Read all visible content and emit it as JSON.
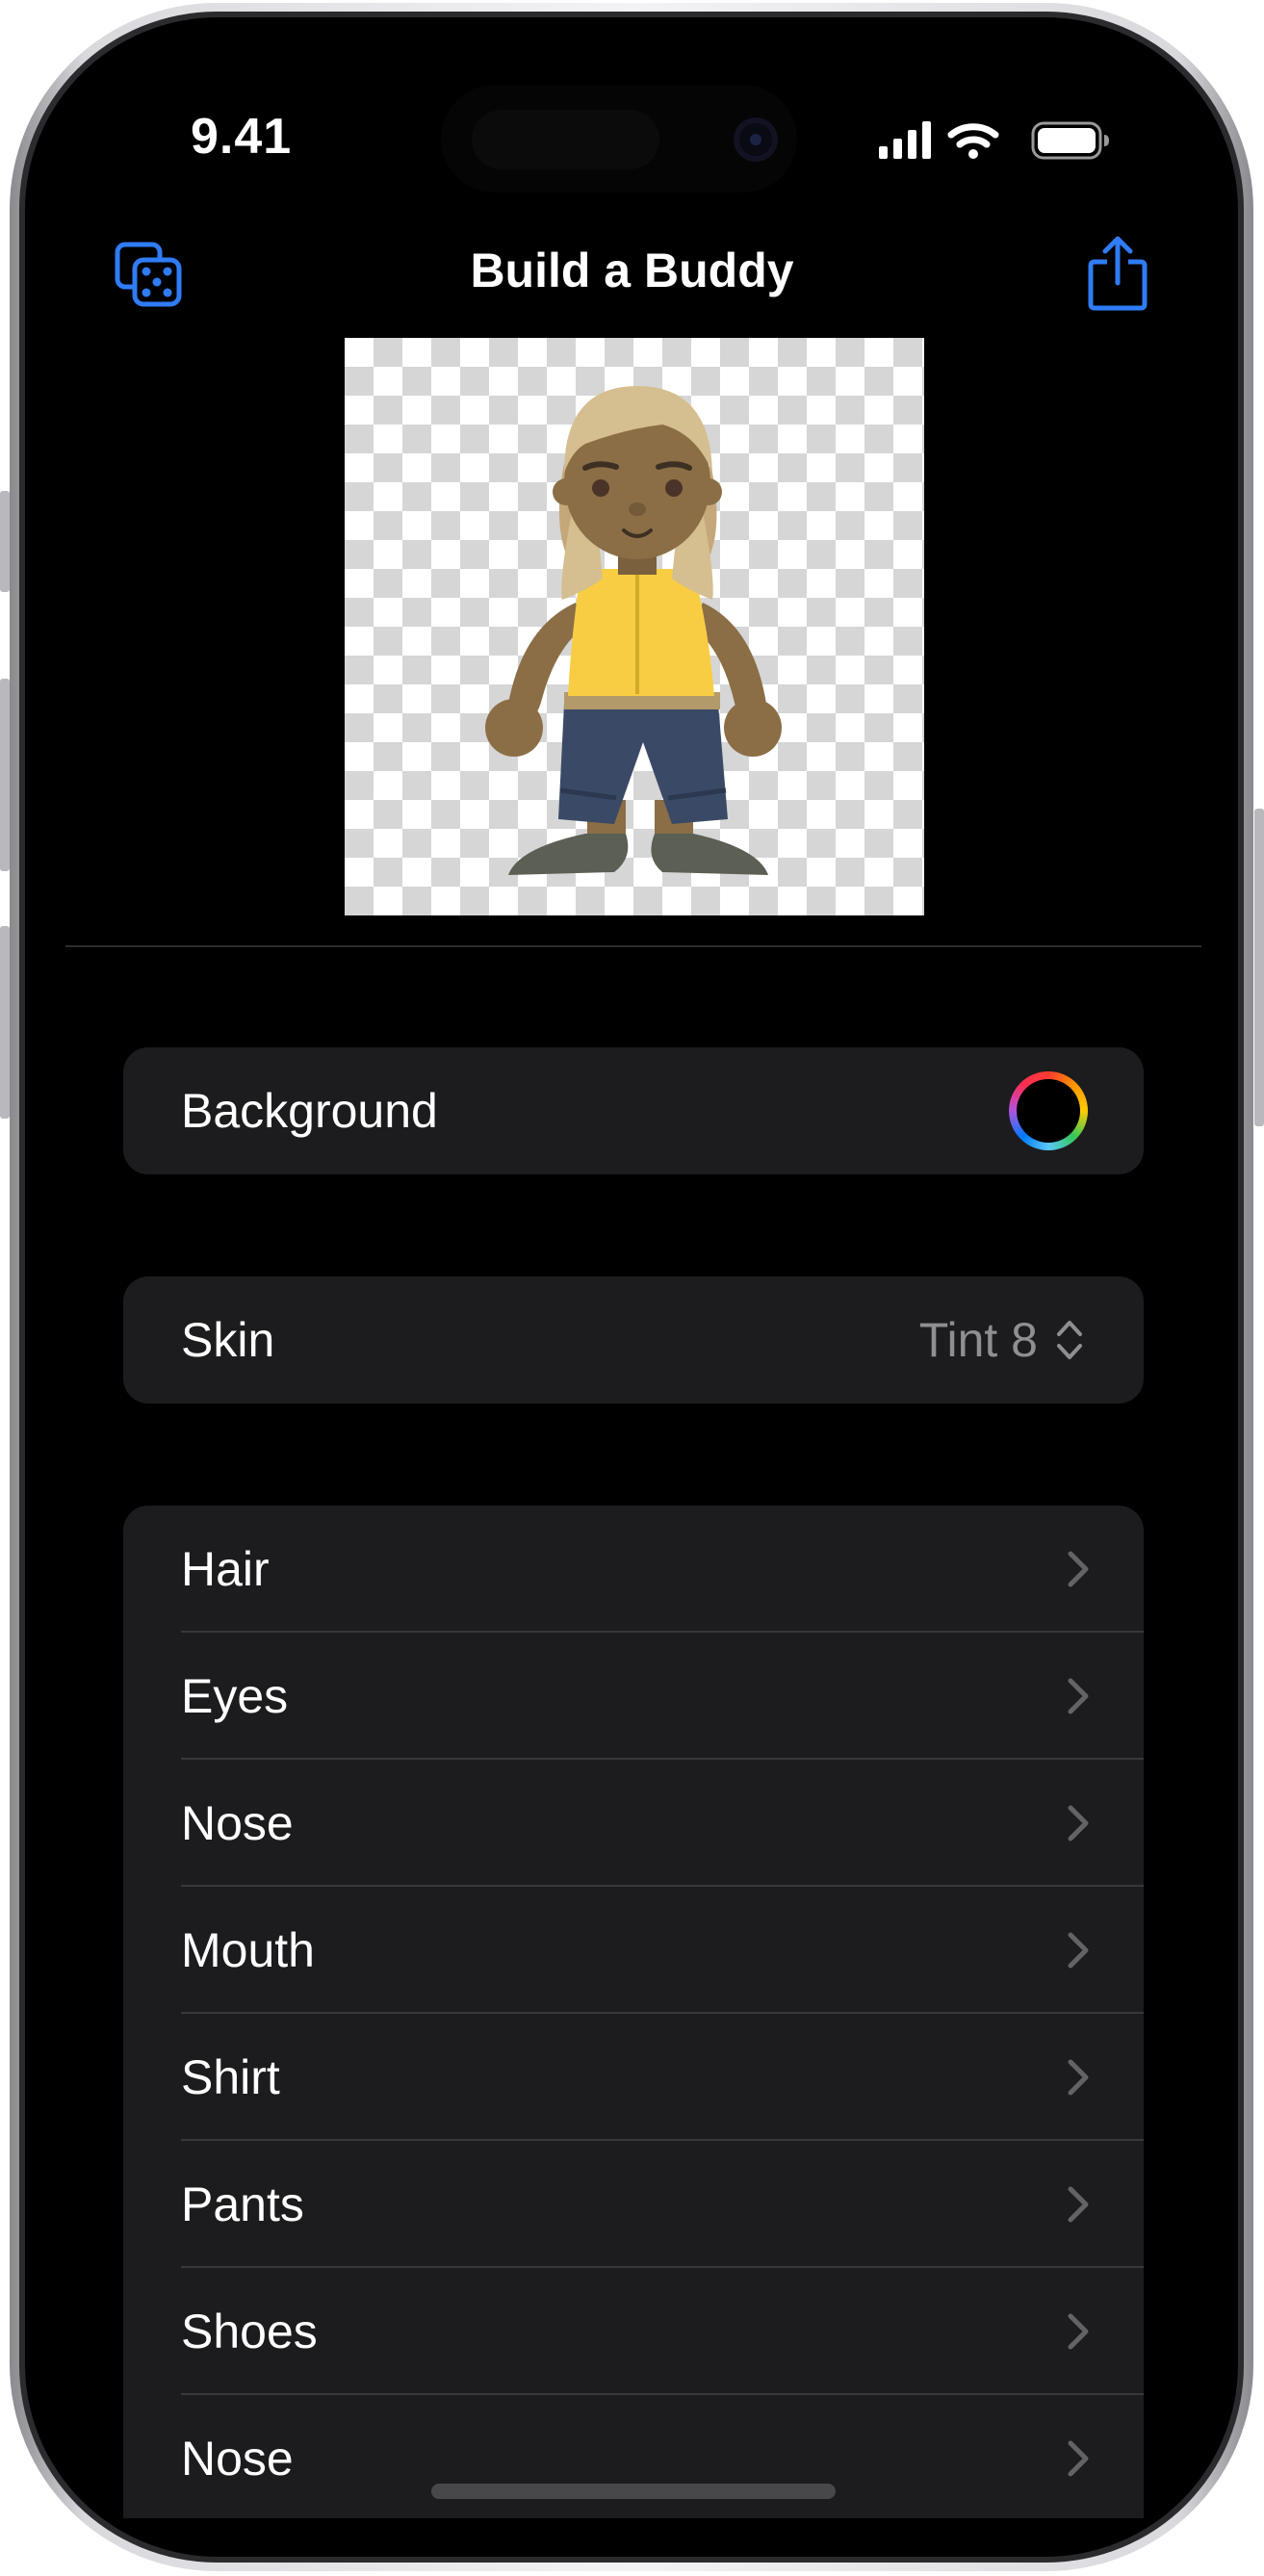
{
  "status_bar": {
    "time": "9.41"
  },
  "nav": {
    "title": "Build a Buddy"
  },
  "settings": {
    "background": {
      "label": "Background"
    },
    "skin": {
      "label": "Skin",
      "value": "Tint 8"
    }
  },
  "features": [
    {
      "label": "Hair"
    },
    {
      "label": "Eyes"
    },
    {
      "label": "Nose"
    },
    {
      "label": "Mouth"
    },
    {
      "label": "Shirt"
    },
    {
      "label": "Pants"
    },
    {
      "label": "Shoes"
    },
    {
      "label": "Nose"
    }
  ],
  "colors": {
    "accent": "#2f7cf6",
    "background": "#000000",
    "cell": "#1c1c1e"
  }
}
